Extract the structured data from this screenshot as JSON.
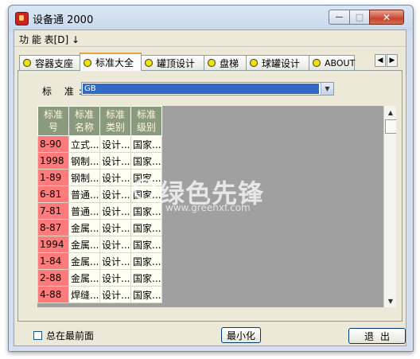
{
  "window": {
    "title": "设备通 2000",
    "minimize": "—",
    "maximize": "□",
    "close": "✕"
  },
  "menu": {
    "item": "功 能 表[D] ↓"
  },
  "tabs": [
    {
      "label": "容器支座",
      "active": false
    },
    {
      "label": "标准大全",
      "active": true
    },
    {
      "label": "罐顶设计",
      "active": false
    },
    {
      "label": "盘梯",
      "active": false
    },
    {
      "label": "球罐设计",
      "active": false
    },
    {
      "label": "ABOUT",
      "active": false
    }
  ],
  "tab_scroll": {
    "left": "◀",
    "right": "▶"
  },
  "standard": {
    "label": "标 准:",
    "value": "GB",
    "arrow": "▼"
  },
  "table": {
    "headers": [
      [
        "标准",
        "号"
      ],
      [
        "标准",
        "名称"
      ],
      [
        "标准",
        "类别"
      ],
      [
        "标准",
        "级别"
      ]
    ],
    "rows": [
      [
        "8-90",
        "立式...",
        "设计...",
        "国家..."
      ],
      [
        "1998",
        "钢制...",
        "设计...",
        "国家..."
      ],
      [
        "1-89",
        "钢制...",
        "设计...",
        "国家..."
      ],
      [
        "6-81",
        "普通...",
        "设计...",
        "国家..."
      ],
      [
        "7-81",
        "普通...",
        "设计...",
        "国家..."
      ],
      [
        "8-87",
        "金属...",
        "设计...",
        "国家..."
      ],
      [
        "1994",
        "金属...",
        "设计...",
        "国家..."
      ],
      [
        "1-84",
        "金属...",
        "设计...",
        "国家..."
      ],
      [
        "2-88",
        "金属...",
        "设计...",
        "国家..."
      ],
      [
        "4-88",
        "焊缝...",
        "设计...",
        "国家..."
      ]
    ]
  },
  "scrollbar": {
    "up": "▲",
    "down": "▼"
  },
  "watermark": {
    "text": "绿色先锋",
    "url": "www.greenxf.com"
  },
  "bottom": {
    "always_on_top": "总在最前面",
    "minimize_btn": "最小化",
    "exit_btn": "退出"
  },
  "colors": {
    "header_bg": "#8a9a7c",
    "id_col_bg": "#ff7b7b",
    "select_bg": "#316ac5",
    "grid_bg": "#a0a0a0"
  }
}
